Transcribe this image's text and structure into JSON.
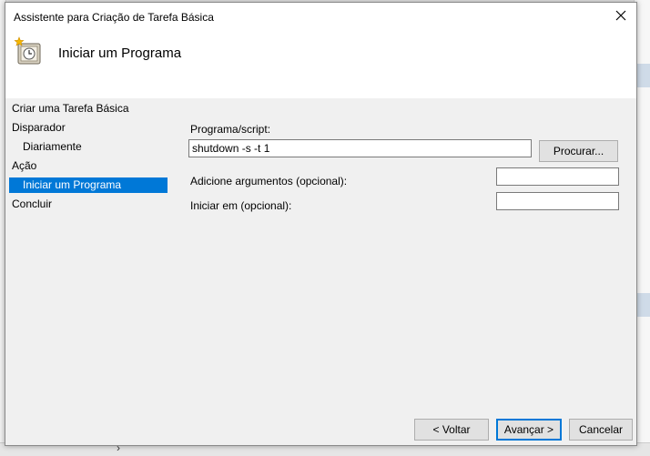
{
  "dialog": {
    "title": "Assistente para Criação de Tarefa Básica",
    "header_title": "Iniciar um Programa"
  },
  "steps": [
    {
      "label": "Criar uma Tarefa Básica",
      "selected": false
    },
    {
      "label": "Disparador",
      "selected": false
    },
    {
      "label": "Diariamente",
      "selected": false
    },
    {
      "label": "Ação",
      "selected": false
    },
    {
      "label": "Iniciar um Programa",
      "selected": true
    },
    {
      "label": "Concluir",
      "selected": false
    }
  ],
  "form": {
    "program_label": "Programa/script:",
    "program_value": "shutdown -s -t 1",
    "browse_label": "Procurar...",
    "args_label": "Adicione argumentos (opcional):",
    "args_value": "",
    "start_in_label": "Iniciar em (opcional):",
    "start_in_value": ""
  },
  "footer": {
    "back_label": "< Voltar",
    "next_label": "Avançar >",
    "cancel_label": "Cancelar"
  },
  "colors": {
    "accent": "#0078d7",
    "dialog_bg": "#f0f0f0",
    "header_bg": "#ffffff"
  },
  "icons": {
    "close": "close-icon",
    "header": "scheduled-task-clock-icon"
  }
}
